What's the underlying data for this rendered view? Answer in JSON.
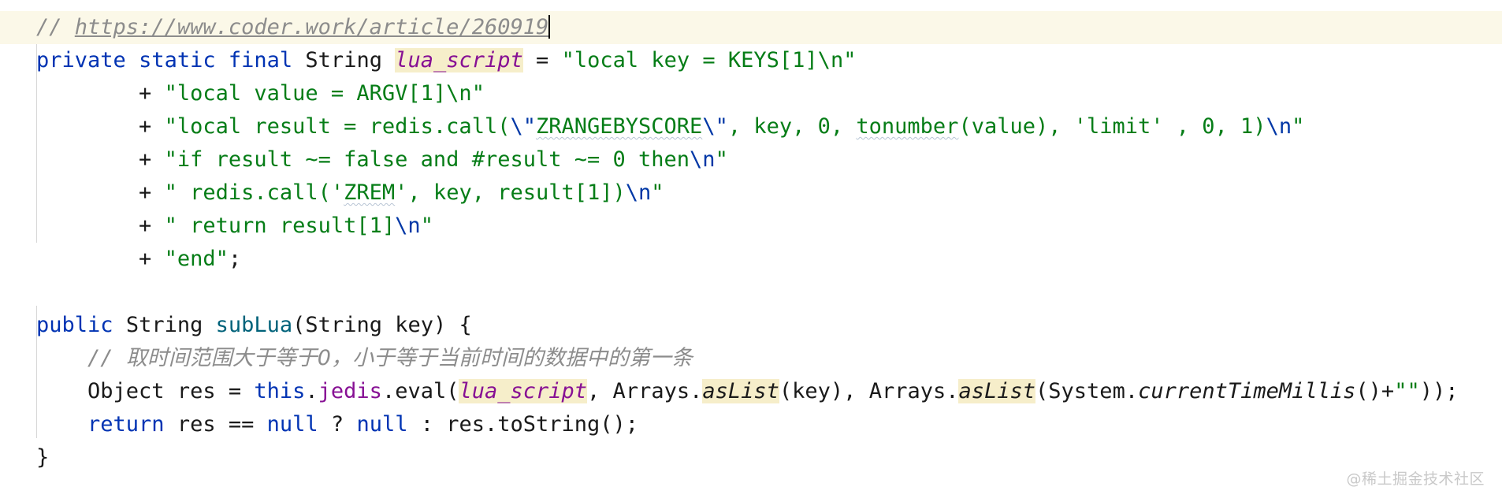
{
  "editor": {
    "language": "java",
    "background_color": "#ffffff",
    "current_line_highlight_color": "#fbf8e8",
    "caret_color": "#000000",
    "colors": {
      "keyword": "#0033b3",
      "string": "#067d17",
      "escape": "#0037a6",
      "field": "#871094",
      "static_field": "#871094",
      "method_declaration": "#00627a",
      "comment": "#8c8c8c",
      "static_highlight_bg": "#f6eeca",
      "indent_guide": "#d7d7d7",
      "text": "#1a1a1a"
    }
  },
  "code": {
    "line1": {
      "comment_marker": "// ",
      "url": "https://www.coder.work/article/260919"
    },
    "line2": {
      "kw_private": "private",
      "kw_static": "static",
      "kw_final": "final",
      "type_string": "String",
      "var_name": "lua_script",
      "equals": " = ",
      "string": "\"local key = KEYS[1]\\n\""
    },
    "line3": {
      "plus": "+ ",
      "string": "\"local value = ARGV[1]\\n\""
    },
    "line4": {
      "plus": "+ ",
      "part1": "\"local result = redis.call(",
      "esc1": "\\\"",
      "word1": "ZRANGEBYSCORE",
      "esc2": "\\\"",
      "part2": ", key, 0, ",
      "word2": "tonumber",
      "part3": "(value), 'limit' , 0, 1)",
      "esc3": "\\n",
      "part4": "\""
    },
    "line5": {
      "plus": "+ ",
      "part1": "\"if result ~= false and #result ~= 0 then",
      "esc": "\\n",
      "part2": "\""
    },
    "line6": {
      "plus": "+ ",
      "part1": "\" redis.call('",
      "word": "ZREM",
      "part2": "', key, result[1])",
      "esc": "\\n",
      "part3": "\""
    },
    "line7": {
      "plus": "+ ",
      "part1": "\" return result[1]",
      "esc": "\\n",
      "part2": "\""
    },
    "line8": {
      "plus": "+ ",
      "string": "\"end\"",
      "semicolon": ";"
    },
    "line9": {
      "text": ""
    },
    "line10": {
      "kw_public": "public",
      "type_string": "String",
      "method_name": "subLua",
      "params": "(String key) {"
    },
    "line11": {
      "marker": "// ",
      "text": "取时间范围大于等于0，小于等于当前时间的数据中的第一条"
    },
    "line12": {
      "part1": "Object res = ",
      "kw_this": "this",
      "dot1": ".",
      "field_jedis": "jedis",
      "dot2": ".eval(",
      "var_lua": "lua_script",
      "part2": ", Arrays.",
      "static1": "asList",
      "part3": "(key), Arrays.",
      "static2": "asList",
      "part4": "(System.",
      "static3": "currentTimeMillis",
      "part5": "()+",
      "empty_string": "\"\"",
      "part6": "));"
    },
    "line13": {
      "kw_return": "return",
      "part1": " res == ",
      "kw_null1": "null",
      "part2": " ? ",
      "kw_null2": "null",
      "part3": " : res.toString();"
    },
    "line14": {
      "text": "}"
    }
  },
  "watermark": {
    "text": "@稀土掘金技术社区"
  }
}
